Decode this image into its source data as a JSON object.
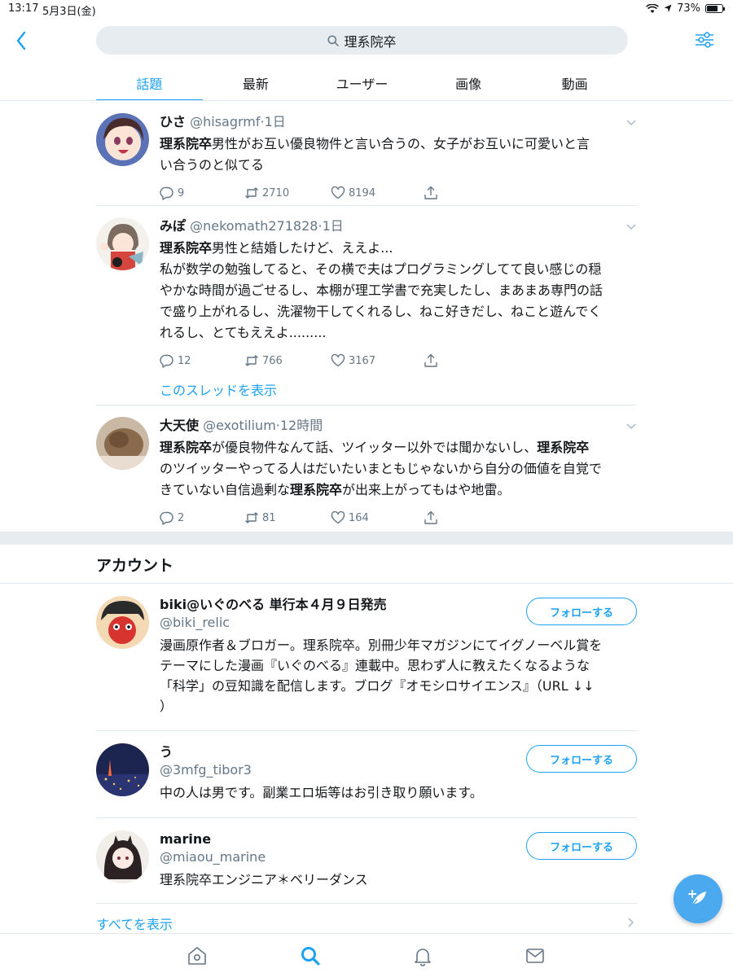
{
  "status": {
    "time": "13:17",
    "date": "5月3日(金)",
    "battery": "73%",
    "battery_level": 0.73
  },
  "search": {
    "query": "理系院卒"
  },
  "tabs": [
    {
      "label": "話題",
      "active": true
    },
    {
      "label": "最新",
      "active": false
    },
    {
      "label": "ユーザー",
      "active": false
    },
    {
      "label": "画像",
      "active": false
    },
    {
      "label": "動画",
      "active": false
    }
  ],
  "tweets": [
    {
      "name": "ひさ",
      "handle": "@hisagrmf",
      "time": "1日",
      "lines": [
        [
          [
            "理系院卒",
            true
          ],
          [
            "男性がお互い優良物件と言い合うの、女子がお互いに可愛いと言",
            false
          ]
        ],
        [
          [
            "い合うのと似てる",
            false
          ]
        ]
      ],
      "replies": "9",
      "retweets": "2710",
      "likes": "8194"
    },
    {
      "name": "みぽ",
      "handle": "@nekomath271828",
      "time": "1日",
      "lines": [
        [
          [
            "理系院卒",
            true
          ],
          [
            "男性と結婚したけど、ええよ...",
            false
          ]
        ],
        [
          [
            "私が数学の勉強してると、その横で夫はプログラミングしてて良い感じの穏",
            false
          ]
        ],
        [
          [
            "やかな時間が過ごせるし、本棚が理工学書で充実したし、まあまあ専門の話",
            false
          ]
        ],
        [
          [
            "で盛り上がれるし、洗濯物干してくれるし、ねこ好きだし、ねこと遊んでく",
            false
          ]
        ],
        [
          [
            "れるし、とてもええよ.........",
            false
          ]
        ]
      ],
      "replies": "12",
      "retweets": "766",
      "likes": "3167",
      "thread_link": "このスレッドを表示"
    },
    {
      "name": "大天使",
      "handle": "@exotilium",
      "time": "12時間",
      "lines": [
        [
          [
            "理系院卒",
            true
          ],
          [
            "が優良物件なんて話、ツイッター以外では聞かないし、",
            false
          ],
          [
            "理系院卒",
            true
          ]
        ],
        [
          [
            "のツイッターやってる人はだいたいまともじゃないから自分の価値を自覚で",
            false
          ]
        ],
        [
          [
            "きていない自信過剰な",
            false
          ],
          [
            "理系院卒",
            true
          ],
          [
            "が出来上がってもはや地雷。",
            false
          ]
        ]
      ],
      "replies": "2",
      "retweets": "81",
      "likes": "164"
    }
  ],
  "accounts_section": {
    "title": "アカウント",
    "follow_label": "フォローする",
    "show_all": "すべてを表示",
    "accounts": [
      {
        "name": "biki@いぐのべる 単行本４月９日発売",
        "handle": "@biki_relic",
        "bio_lines": [
          "漫画原作者＆ブロガー。理系院卒。別冊少年マガジンにてイグノーベル賞を",
          "テーマにした漫画『いぐのべる』連載中。思わず人に教えたくなるような",
          "「科学」の豆知識を配信します。ブログ『オモシロサイエンス』（URL ↓↓",
          "）"
        ]
      },
      {
        "name": "う",
        "handle": "@3mfg_tibor3",
        "bio_lines": [
          "中の人は男です。副業エロ垢等はお引き取り願います。"
        ]
      },
      {
        "name": "marine",
        "handle": "@miaou_marine",
        "bio_lines": [
          "理系院卒エンジニア＊ベリーダンス"
        ]
      }
    ]
  },
  "colors": {
    "accent": "#1da1f2",
    "muted": "#657786",
    "divider": "#e1e8ed",
    "fab": "#4aa9ef"
  },
  "icons": [
    "chevron-left-icon",
    "search-icon",
    "filter-icon",
    "reply-icon",
    "retweet-icon",
    "like-icon",
    "share-icon",
    "compose-icon",
    "home-icon",
    "notification-icon",
    "message-icon"
  ]
}
